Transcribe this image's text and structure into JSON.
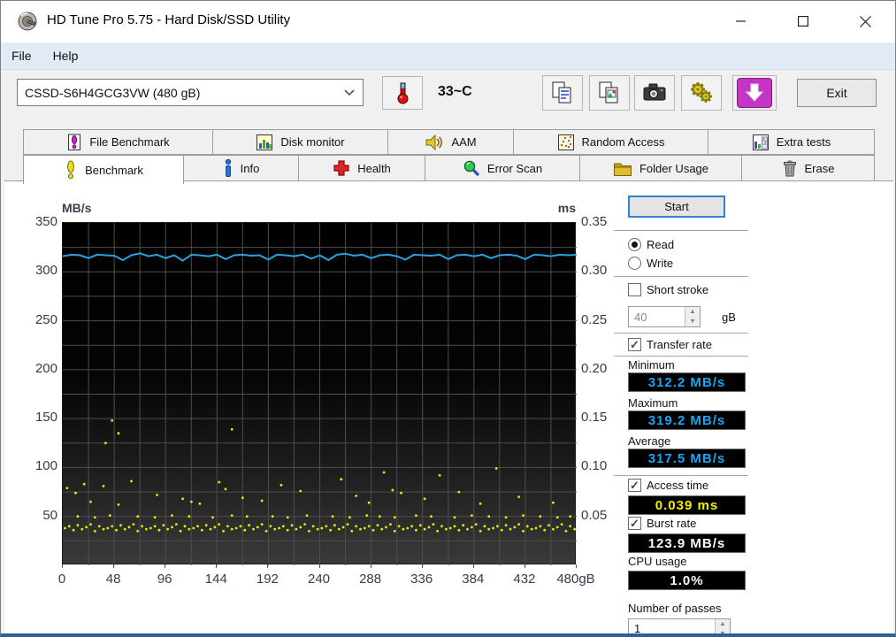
{
  "window": {
    "title": "HD Tune Pro 5.75 - Hard Disk/SSD Utility"
  },
  "menu": {
    "items": [
      {
        "label": "File"
      },
      {
        "label": "Help"
      }
    ]
  },
  "toolbar": {
    "drive_select": "CSSD-S6H4GCG3VW (480 gB)",
    "temperature": "33~C",
    "exit_label": "Exit"
  },
  "tabs": {
    "row1": [
      {
        "label": "File Benchmark"
      },
      {
        "label": "Disk monitor"
      },
      {
        "label": "AAM"
      },
      {
        "label": "Random Access"
      },
      {
        "label": "Extra tests"
      }
    ],
    "row2": [
      {
        "label": "Benchmark",
        "active": true
      },
      {
        "label": "Info"
      },
      {
        "label": "Health"
      },
      {
        "label": "Error Scan"
      },
      {
        "label": "Folder Usage"
      },
      {
        "label": "Erase"
      }
    ]
  },
  "controls": {
    "start_label": "Start",
    "read_label": "Read",
    "write_label": "Write",
    "short_stroke_label": "Short stroke",
    "capacity_value": "40",
    "capacity_unit": "gB",
    "transfer_rate_label": "Transfer rate",
    "minimum_label": "Minimum",
    "minimum_value": "312.2 MB/s",
    "maximum_label": "Maximum",
    "maximum_value": "319.2 MB/s",
    "average_label": "Average",
    "average_value": "317.5 MB/s",
    "access_time_label": "Access time",
    "access_time_value": "0.039 ms",
    "burst_rate_label": "Burst rate",
    "burst_rate_value": "123.9 MB/s",
    "cpu_usage_label": "CPU usage",
    "cpu_usage_value": "1.0%",
    "passes_label": "Number of passes",
    "passes_value": "1"
  },
  "icons": {
    "check": "✓",
    "spin_up": "▲",
    "spin_down": "▼"
  },
  "chart_data": {
    "type": "line+scatter",
    "x_max": 480,
    "x_ticks": [
      0,
      48,
      96,
      144,
      192,
      240,
      288,
      336,
      384,
      432,
      480
    ],
    "x_tick_labels": [
      "0",
      "48",
      "96",
      "144",
      "192",
      "240",
      "288",
      "336",
      "384",
      "432",
      "480gB"
    ],
    "left_axis": {
      "label": "MB/s",
      "min": 0,
      "max": 350,
      "ticks": [
        350,
        300,
        250,
        200,
        150,
        100,
        50
      ],
      "grid_step": 25
    },
    "right_axis": {
      "label": "ms",
      "min": 0,
      "max": 0.35,
      "ticks": [
        0.35,
        0.3,
        0.25,
        0.2,
        0.15,
        0.1,
        0.05
      ]
    },
    "grid": {
      "x_step": 24,
      "color": "#4e4e4e"
    },
    "stats": {
      "minimum_mbs": 312.2,
      "maximum_mbs": 319.2,
      "average_mbs": 317.5,
      "access_time_ms": 0.039,
      "burst_rate_mbs": 123.9,
      "cpu_usage_pct": 1.0
    },
    "series": [
      {
        "name": "transfer_rate",
        "type": "line",
        "axis": "left",
        "color": "#2aa3dc",
        "points": [
          [
            0,
            316
          ],
          [
            8,
            317.5
          ],
          [
            16,
            317
          ],
          [
            24,
            314
          ],
          [
            32,
            317.5
          ],
          [
            40,
            317
          ],
          [
            48,
            316.5
          ],
          [
            56,
            312
          ],
          [
            64,
            317
          ],
          [
            72,
            319
          ],
          [
            80,
            316
          ],
          [
            88,
            317.5
          ],
          [
            96,
            314
          ],
          [
            104,
            317
          ],
          [
            112,
            311.5
          ],
          [
            120,
            317.5
          ],
          [
            128,
            317
          ],
          [
            136,
            316
          ],
          [
            144,
            317.5
          ],
          [
            152,
            313
          ],
          [
            160,
            317
          ],
          [
            168,
            317.5
          ],
          [
            176,
            316.5
          ],
          [
            184,
            317
          ],
          [
            192,
            312.5
          ],
          [
            200,
            317.5
          ],
          [
            208,
            317
          ],
          [
            216,
            316
          ],
          [
            224,
            317.5
          ],
          [
            232,
            313.5
          ],
          [
            240,
            317
          ],
          [
            248,
            312
          ],
          [
            256,
            317.5
          ],
          [
            264,
            318.5
          ],
          [
            272,
            316.5
          ],
          [
            280,
            317.5
          ],
          [
            288,
            314
          ],
          [
            296,
            317
          ],
          [
            304,
            317.5
          ],
          [
            312,
            316
          ],
          [
            320,
            312.5
          ],
          [
            328,
            317.5
          ],
          [
            336,
            317
          ],
          [
            344,
            316.5
          ],
          [
            352,
            317.5
          ],
          [
            360,
            313
          ],
          [
            368,
            317
          ],
          [
            376,
            317.5
          ],
          [
            384,
            316
          ],
          [
            392,
            317.5
          ],
          [
            400,
            314
          ],
          [
            408,
            317
          ],
          [
            416,
            317.5
          ],
          [
            424,
            316.5
          ],
          [
            432,
            313
          ],
          [
            440,
            317.5
          ],
          [
            448,
            317
          ],
          [
            456,
            316
          ],
          [
            464,
            317.5
          ],
          [
            472,
            317
          ],
          [
            480,
            317.5
          ]
        ]
      },
      {
        "name": "access_time",
        "type": "scatter",
        "axis": "right",
        "color": "#eaea00",
        "points": [
          [
            2,
            0.038
          ],
          [
            6,
            0.04
          ],
          [
            10,
            0.036
          ],
          [
            14,
            0.041
          ],
          [
            18,
            0.037
          ],
          [
            22,
            0.039
          ],
          [
            26,
            0.042
          ],
          [
            30,
            0.035
          ],
          [
            34,
            0.04
          ],
          [
            38,
            0.037
          ],
          [
            42,
            0.038
          ],
          [
            46,
            0.04
          ],
          [
            50,
            0.036
          ],
          [
            54,
            0.041
          ],
          [
            58,
            0.037
          ],
          [
            62,
            0.039
          ],
          [
            66,
            0.042
          ],
          [
            70,
            0.035
          ],
          [
            74,
            0.04
          ],
          [
            78,
            0.037
          ],
          [
            82,
            0.038
          ],
          [
            86,
            0.04
          ],
          [
            90,
            0.036
          ],
          [
            94,
            0.041
          ],
          [
            98,
            0.037
          ],
          [
            102,
            0.039
          ],
          [
            106,
            0.042
          ],
          [
            110,
            0.035
          ],
          [
            114,
            0.04
          ],
          [
            118,
            0.037
          ],
          [
            122,
            0.038
          ],
          [
            126,
            0.04
          ],
          [
            130,
            0.036
          ],
          [
            134,
            0.041
          ],
          [
            138,
            0.037
          ],
          [
            142,
            0.039
          ],
          [
            146,
            0.042
          ],
          [
            150,
            0.035
          ],
          [
            154,
            0.04
          ],
          [
            158,
            0.037
          ],
          [
            162,
            0.038
          ],
          [
            166,
            0.04
          ],
          [
            170,
            0.036
          ],
          [
            174,
            0.041
          ],
          [
            178,
            0.037
          ],
          [
            182,
            0.039
          ],
          [
            186,
            0.042
          ],
          [
            190,
            0.035
          ],
          [
            194,
            0.04
          ],
          [
            198,
            0.037
          ],
          [
            202,
            0.038
          ],
          [
            206,
            0.04
          ],
          [
            210,
            0.036
          ],
          [
            214,
            0.041
          ],
          [
            218,
            0.037
          ],
          [
            222,
            0.039
          ],
          [
            226,
            0.042
          ],
          [
            230,
            0.035
          ],
          [
            234,
            0.04
          ],
          [
            238,
            0.037
          ],
          [
            242,
            0.038
          ],
          [
            246,
            0.04
          ],
          [
            250,
            0.036
          ],
          [
            254,
            0.041
          ],
          [
            258,
            0.037
          ],
          [
            262,
            0.039
          ],
          [
            266,
            0.042
          ],
          [
            270,
            0.035
          ],
          [
            274,
            0.04
          ],
          [
            278,
            0.037
          ],
          [
            282,
            0.038
          ],
          [
            286,
            0.04
          ],
          [
            290,
            0.036
          ],
          [
            294,
            0.041
          ],
          [
            298,
            0.037
          ],
          [
            302,
            0.039
          ],
          [
            306,
            0.042
          ],
          [
            310,
            0.035
          ],
          [
            314,
            0.04
          ],
          [
            318,
            0.037
          ],
          [
            322,
            0.038
          ],
          [
            326,
            0.04
          ],
          [
            330,
            0.036
          ],
          [
            334,
            0.041
          ],
          [
            338,
            0.037
          ],
          [
            342,
            0.039
          ],
          [
            346,
            0.042
          ],
          [
            350,
            0.035
          ],
          [
            354,
            0.04
          ],
          [
            358,
            0.037
          ],
          [
            362,
            0.038
          ],
          [
            366,
            0.04
          ],
          [
            370,
            0.036
          ],
          [
            374,
            0.041
          ],
          [
            378,
            0.037
          ],
          [
            382,
            0.039
          ],
          [
            386,
            0.042
          ],
          [
            390,
            0.035
          ],
          [
            394,
            0.04
          ],
          [
            398,
            0.037
          ],
          [
            402,
            0.038
          ],
          [
            406,
            0.04
          ],
          [
            410,
            0.036
          ],
          [
            414,
            0.041
          ],
          [
            418,
            0.037
          ],
          [
            422,
            0.039
          ],
          [
            426,
            0.042
          ],
          [
            430,
            0.035
          ],
          [
            434,
            0.04
          ],
          [
            438,
            0.037
          ],
          [
            442,
            0.038
          ],
          [
            446,
            0.04
          ],
          [
            450,
            0.036
          ],
          [
            454,
            0.041
          ],
          [
            458,
            0.037
          ],
          [
            462,
            0.039
          ],
          [
            466,
            0.042
          ],
          [
            470,
            0.035
          ],
          [
            474,
            0.04
          ],
          [
            478,
            0.037
          ],
          [
            14,
            0.05
          ],
          [
            30,
            0.049
          ],
          [
            44,
            0.051
          ],
          [
            70,
            0.05
          ],
          [
            86,
            0.049
          ],
          [
            102,
            0.051
          ],
          [
            118,
            0.05
          ],
          [
            140,
            0.049
          ],
          [
            158,
            0.051
          ],
          [
            172,
            0.05
          ],
          [
            196,
            0.05
          ],
          [
            210,
            0.049
          ],
          [
            228,
            0.051
          ],
          [
            252,
            0.05
          ],
          [
            268,
            0.049
          ],
          [
            284,
            0.051
          ],
          [
            296,
            0.05
          ],
          [
            310,
            0.049
          ],
          [
            330,
            0.051
          ],
          [
            344,
            0.05
          ],
          [
            366,
            0.049
          ],
          [
            382,
            0.051
          ],
          [
            398,
            0.05
          ],
          [
            414,
            0.049
          ],
          [
            430,
            0.051
          ],
          [
            446,
            0.05
          ],
          [
            462,
            0.049
          ],
          [
            474,
            0.05
          ],
          [
            4,
            0.079
          ],
          [
            12,
            0.074
          ],
          [
            20,
            0.083
          ],
          [
            26,
            0.065
          ],
          [
            38,
            0.081
          ],
          [
            52,
            0.062
          ],
          [
            64,
            0.086
          ],
          [
            88,
            0.072
          ],
          [
            112,
            0.068
          ],
          [
            120,
            0.065
          ],
          [
            128,
            0.063
          ],
          [
            146,
            0.085
          ],
          [
            152,
            0.078
          ],
          [
            168,
            0.069
          ],
          [
            186,
            0.066
          ],
          [
            204,
            0.082
          ],
          [
            222,
            0.076
          ],
          [
            260,
            0.088
          ],
          [
            274,
            0.071
          ],
          [
            286,
            0.064
          ],
          [
            300,
            0.095
          ],
          [
            308,
            0.077
          ],
          [
            316,
            0.074
          ],
          [
            338,
            0.068
          ],
          [
            352,
            0.092
          ],
          [
            370,
            0.075
          ],
          [
            390,
            0.063
          ],
          [
            405,
            0.099
          ],
          [
            426,
            0.07
          ],
          [
            458,
            0.064
          ],
          [
            40,
            0.125
          ],
          [
            46,
            0.148
          ],
          [
            52,
            0.135
          ],
          [
            158,
            0.139
          ]
        ]
      }
    ]
  }
}
